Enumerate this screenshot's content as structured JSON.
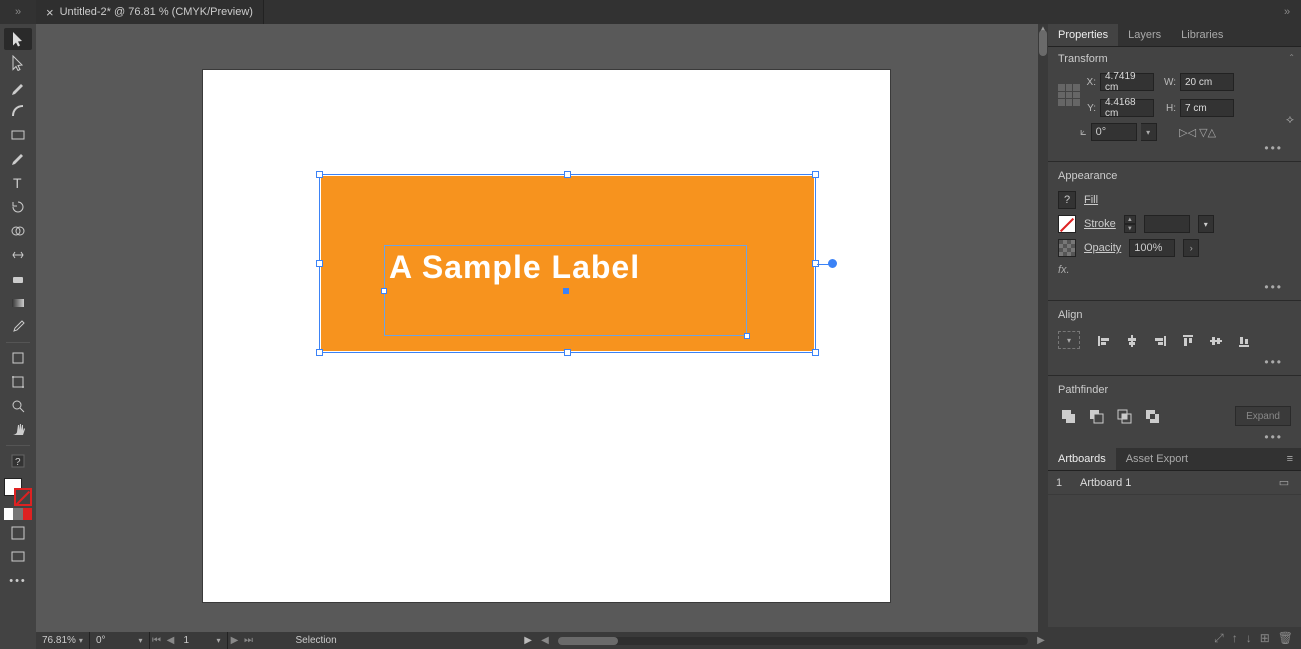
{
  "tabbar": {
    "expand_left": "»",
    "doc_title": "Untitled-2* @ 76.81 % (CMYK/Preview)",
    "close": "×",
    "expand_right": "»"
  },
  "canvas": {
    "sample_text": "A Sample Label",
    "orange_color": "#f7931e"
  },
  "status": {
    "zoom": "76.81%",
    "rotate": "0°",
    "page": "1",
    "mode": "Selection"
  },
  "panels": {
    "tabs": {
      "properties": "Properties",
      "layers": "Layers",
      "libraries": "Libraries"
    },
    "transform": {
      "title": "Transform",
      "x_label": "X:",
      "x_value": "4.7419 cm",
      "y_label": "Y:",
      "y_value": "4.4168 cm",
      "w_label": "W:",
      "w_value": "20 cm",
      "h_label": "H:",
      "h_value": "7 cm",
      "angle": "0°"
    },
    "appearance": {
      "title": "Appearance",
      "fill": "Fill",
      "stroke": "Stroke",
      "opacity": "Opacity",
      "opacity_value": "100%",
      "fx": "fx."
    },
    "align": {
      "title": "Align"
    },
    "pathfinder": {
      "title": "Pathfinder",
      "expand": "Expand"
    },
    "artboards_tabs": {
      "artboards": "Artboards",
      "asset_export": "Asset Export"
    },
    "artboards": [
      {
        "index": "1",
        "name": "Artboard 1"
      }
    ]
  }
}
